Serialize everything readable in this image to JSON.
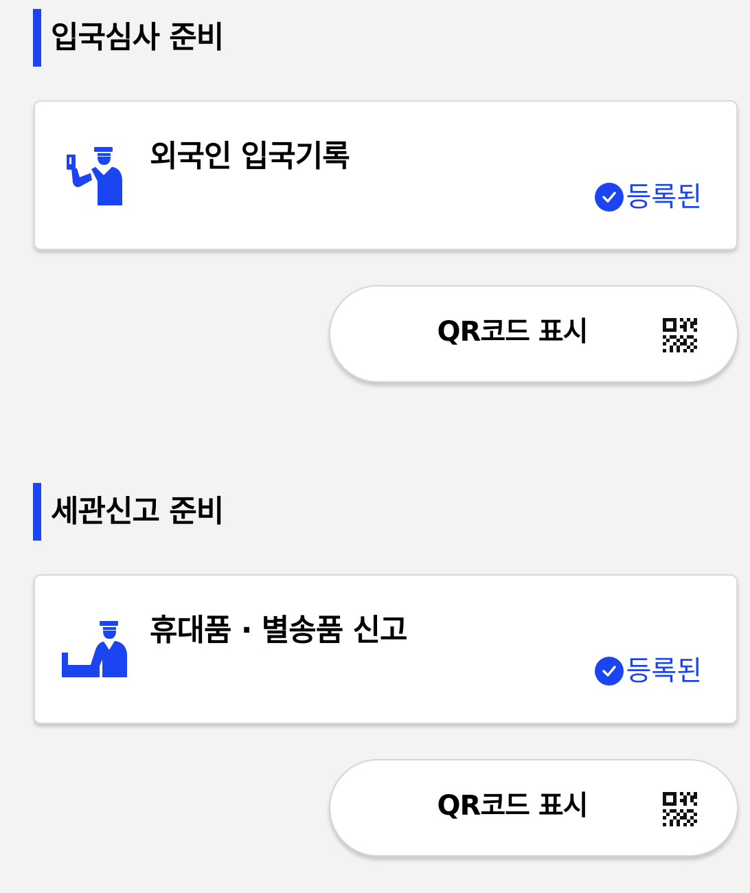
{
  "sections": [
    {
      "heading": "입국심사 준비",
      "card": {
        "title": "외국인 입국기록",
        "icon": "immigration-officer-icon",
        "status": "등록된"
      },
      "qr_button": {
        "label": "QR코드 표시",
        "icon": "qr-code-icon"
      }
    },
    {
      "heading": "세관신고 준비",
      "card": {
        "title": "휴대품 · 별송품 신고",
        "icon": "customs-officer-icon",
        "status": "등록된"
      },
      "qr_button": {
        "label": "QR코드 표시",
        "icon": "qr-code-icon"
      }
    }
  ],
  "colors": {
    "accent": "#1b45f0",
    "background": "#f3f3f3",
    "card": "#ffffff"
  }
}
